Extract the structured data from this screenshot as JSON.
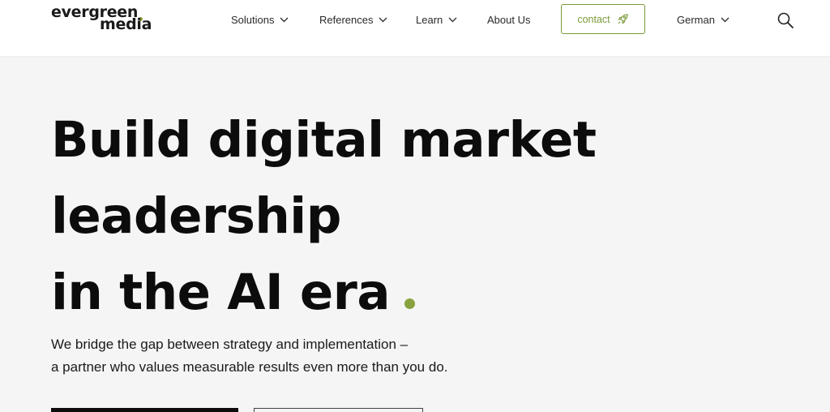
{
  "logo": {
    "line1": "evergreen",
    "line2": "media",
    "accent_color": "#8aa23e"
  },
  "nav": {
    "items": [
      {
        "label": "Solutions",
        "has_dropdown": true,
        "icon": "chevron-down-icon"
      },
      {
        "label": "References",
        "has_dropdown": true,
        "icon": "chevron-down-icon"
      },
      {
        "label": "Learn",
        "has_dropdown": true,
        "icon": "chevron-down-icon"
      },
      {
        "label": "About Us",
        "has_dropdown": false
      }
    ],
    "contact": {
      "label": "contact",
      "icon": "rocket-icon",
      "color": "#7a9a3a"
    },
    "language": {
      "label": "German",
      "icon": "chevron-down-icon"
    },
    "search": {
      "icon": "search-icon"
    }
  },
  "hero": {
    "title_lines": [
      "Build digital market",
      "leadership",
      "in the AI era"
    ],
    "accent_color": "#8aa23e",
    "subtitle_lines": [
      "We bridge the gap between strategy and implementation –",
      "a partner who values measurable results even more than you do."
    ]
  }
}
